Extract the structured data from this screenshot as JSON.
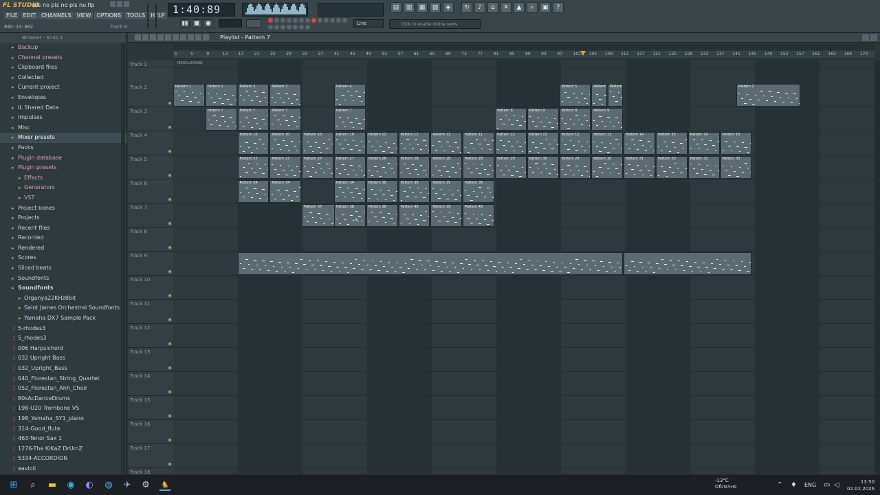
{
  "app": {
    "logo": "FL STUDIO",
    "file_title": "pls no pls no pls no.flp",
    "menu": [
      "FILE",
      "EDIT",
      "CHANNELS",
      "VIEW",
      "OPTIONS",
      "TOOLS",
      "HELP"
    ],
    "time_readout": "044:13:002",
    "track_label": "Track 8",
    "song_time": "1:40:89",
    "line_mode": "Line",
    "news_text": "Click to enable online news"
  },
  "browser": {
    "header": "Browser - Snap 1",
    "items": [
      {
        "label": "Backup",
        "kind": "folder",
        "style": "pink"
      },
      {
        "label": "Channel presets",
        "kind": "folder",
        "style": "pink"
      },
      {
        "label": "Clipboard files",
        "kind": "folder",
        "style": ""
      },
      {
        "label": "Collected",
        "kind": "folder",
        "style": ""
      },
      {
        "label": "Current project",
        "kind": "folder",
        "style": ""
      },
      {
        "label": "Envelopes",
        "kind": "folder",
        "style": ""
      },
      {
        "label": "IL Shared Data",
        "kind": "folder",
        "style": ""
      },
      {
        "label": "Impulses",
        "kind": "folder",
        "style": ""
      },
      {
        "label": "Misc",
        "kind": "folder",
        "style": ""
      },
      {
        "label": "Mixer presets",
        "kind": "folder",
        "style": "sel"
      },
      {
        "label": "Packs",
        "kind": "folder",
        "style": ""
      },
      {
        "label": "Plugin database",
        "kind": "folder",
        "style": "pink"
      },
      {
        "label": "Plugin presets",
        "kind": "folder",
        "style": "pink"
      },
      {
        "label": "Effects",
        "kind": "sub",
        "style": "pink"
      },
      {
        "label": "Generators",
        "kind": "sub",
        "style": "pink"
      },
      {
        "label": "VST",
        "kind": "sub",
        "style": "pink"
      },
      {
        "label": "Project bones",
        "kind": "folder",
        "style": ""
      },
      {
        "label": "Projects",
        "kind": "folder",
        "style": ""
      },
      {
        "label": "Recent files",
        "kind": "folder",
        "style": ""
      },
      {
        "label": "Recorded",
        "kind": "folder",
        "style": ""
      },
      {
        "label": "Rendered",
        "kind": "folder",
        "style": ""
      },
      {
        "label": "Scores",
        "kind": "folder",
        "style": ""
      },
      {
        "label": "Sliced beats",
        "kind": "folder",
        "style": ""
      },
      {
        "label": "Soundfonts",
        "kind": "folder",
        "style": ""
      },
      {
        "label": "Soundfonts",
        "kind": "folder",
        "style": "bold"
      },
      {
        "label": "Organya22KHz8bit",
        "kind": "sub",
        "style": ""
      },
      {
        "label": "Saint James Orchestral Soundfonts",
        "kind": "sub",
        "style": ""
      },
      {
        "label": "Yamaha DX7 Sample Pack",
        "kind": "sub",
        "style": ""
      },
      {
        "label": "5-rhodes3",
        "kind": "file",
        "style": ""
      },
      {
        "label": "5_rhodes3",
        "kind": "file",
        "style": ""
      },
      {
        "label": "006 Harpsichord",
        "kind": "file",
        "style": ""
      },
      {
        "label": "032 Upright Bass",
        "kind": "file",
        "style": ""
      },
      {
        "label": "032_Upright_Bass",
        "kind": "file",
        "style": ""
      },
      {
        "label": "040_Florestan_String_Quartet",
        "kind": "file",
        "style": ""
      },
      {
        "label": "052_Florestan_Ahh_Choir",
        "kind": "file",
        "style": ""
      },
      {
        "label": "80sAcDanceDrums",
        "kind": "file",
        "style": ""
      },
      {
        "label": "198-U20 Trombone VS",
        "kind": "file",
        "style": ""
      },
      {
        "label": "198_Yamaha_SY1_piano",
        "kind": "file",
        "style": ""
      },
      {
        "label": "314-Good_flute",
        "kind": "file",
        "style": ""
      },
      {
        "label": "463-Tenor Sax 1",
        "kind": "file",
        "style": ""
      },
      {
        "label": "1276-The KiKaZ DrUmZ",
        "kind": "file",
        "style": ""
      },
      {
        "label": "5334-ACCORDION",
        "kind": "file",
        "style": ""
      },
      {
        "label": "aavioli",
        "kind": "file",
        "style": ""
      },
      {
        "label": "acoustic_grand_piano_ydp_20080910",
        "kind": "file",
        "style": ""
      },
      {
        "label": "ArabicDrums",
        "kind": "file",
        "style": ""
      },
      {
        "label": "Arachno SoundFont - Version 1.0",
        "kind": "file",
        "style": ""
      }
    ]
  },
  "playlist": {
    "title": "Playlist - Pattern 7",
    "ruler": [
      "1",
      "5",
      "9",
      "13",
      "17",
      "21",
      "25",
      "29",
      "33",
      "37",
      "41",
      "45",
      "49",
      "53",
      "57",
      "61",
      "65",
      "69",
      "73",
      "77",
      "81",
      "85",
      "89",
      "93",
      "97",
      "101",
      "105",
      "109",
      "113",
      "117",
      "121",
      "125",
      "129",
      "133",
      "137",
      "141",
      "145",
      "149",
      "153",
      "157",
      "161",
      "165",
      "169",
      "173"
    ],
    "tracks": [
      "Track 1",
      "Track 2",
      "Track 3",
      "Track 4",
      "Track 5",
      "Track 6",
      "Track 7",
      "Track 8",
      "Track 9",
      "Track 10",
      "Track 11",
      "Track 12",
      "Track 13",
      "Track 14",
      "Track 15",
      "Track 16",
      "Track 17",
      "Track 18"
    ],
    "marker_label": "MEGALOVANIA",
    "clips": [
      {
        "track": 1,
        "pattern": "Pattern 1",
        "start": 0,
        "len": 2
      },
      {
        "track": 1,
        "pattern": "Pattern 1",
        "start": 2,
        "len": 2
      },
      {
        "track": 1,
        "pattern": "Pattern 3",
        "start": 4,
        "len": 2
      },
      {
        "track": 1,
        "pattern": "Pattern 3",
        "start": 6,
        "len": 2
      },
      {
        "track": 1,
        "pattern": "Pattern 4",
        "start": 10,
        "len": 2
      },
      {
        "track": 1,
        "pattern": "Pattern 5",
        "start": 24,
        "len": 2
      },
      {
        "track": 1,
        "pattern": "Pattern 5",
        "start": 26,
        "len": 1
      },
      {
        "track": 1,
        "pattern": "Pattern 5",
        "start": 27,
        "len": 1
      },
      {
        "track": 1,
        "pattern": "Pattern 2",
        "start": 35,
        "len": 4
      },
      {
        "track": 2,
        "pattern": "Pattern 7",
        "start": 2,
        "len": 2
      },
      {
        "track": 2,
        "pattern": "Pattern 7",
        "start": 4,
        "len": 2
      },
      {
        "track": 2,
        "pattern": "Pattern 7",
        "start": 6,
        "len": 2
      },
      {
        "track": 2,
        "pattern": "Pattern 7",
        "start": 10,
        "len": 2
      },
      {
        "track": 2,
        "pattern": "Pattern 8",
        "start": 20,
        "len": 2
      },
      {
        "track": 2,
        "pattern": "Pattern 9",
        "start": 22,
        "len": 2
      },
      {
        "track": 2,
        "pattern": "Pattern 8",
        "start": 24,
        "len": 2
      },
      {
        "track": 2,
        "pattern": "Pattern 9",
        "start": 26,
        "len": 2
      },
      {
        "track": 3,
        "pattern": "Pattern 10",
        "start": 4,
        "len": 2
      },
      {
        "track": 3,
        "pattern": "Pattern 10",
        "start": 6,
        "len": 2
      },
      {
        "track": 3,
        "pattern": "Pattern 10",
        "start": 8,
        "len": 2
      },
      {
        "track": 3,
        "pattern": "Pattern 10",
        "start": 10,
        "len": 2
      },
      {
        "track": 3,
        "pattern": "Pattern 11",
        "start": 12,
        "len": 2
      },
      {
        "track": 3,
        "pattern": "Pattern 11",
        "start": 14,
        "len": 2
      },
      {
        "track": 3,
        "pattern": "Pattern 11",
        "start": 16,
        "len": 2
      },
      {
        "track": 3,
        "pattern": "Pattern 11",
        "start": 18,
        "len": 2
      },
      {
        "track": 3,
        "pattern": "Pattern 12",
        "start": 20,
        "len": 2
      },
      {
        "track": 3,
        "pattern": "Pattern 13",
        "start": 22,
        "len": 2
      },
      {
        "track": 3,
        "pattern": "Pattern 12",
        "start": 24,
        "len": 2
      },
      {
        "track": 3,
        "pattern": "Pattern 13",
        "start": 26,
        "len": 2
      },
      {
        "track": 3,
        "pattern": "Pattern 14",
        "start": 28,
        "len": 2
      },
      {
        "track": 3,
        "pattern": "Pattern 15",
        "start": 30,
        "len": 2
      },
      {
        "track": 3,
        "pattern": "Pattern 14",
        "start": 32,
        "len": 2
      },
      {
        "track": 3,
        "pattern": "Pattern 15",
        "start": 34,
        "len": 2
      },
      {
        "track": 4,
        "pattern": "Pattern 27",
        "start": 4,
        "len": 2
      },
      {
        "track": 4,
        "pattern": "Pattern 27",
        "start": 6,
        "len": 2
      },
      {
        "track": 4,
        "pattern": "Pattern 27",
        "start": 8,
        "len": 2
      },
      {
        "track": 4,
        "pattern": "Pattern 27",
        "start": 10,
        "len": 2
      },
      {
        "track": 4,
        "pattern": "Pattern 28",
        "start": 12,
        "len": 2
      },
      {
        "track": 4,
        "pattern": "Pattern 28",
        "start": 14,
        "len": 2
      },
      {
        "track": 4,
        "pattern": "Pattern 28",
        "start": 16,
        "len": 2
      },
      {
        "track": 4,
        "pattern": "Pattern 28",
        "start": 18,
        "len": 2
      },
      {
        "track": 4,
        "pattern": "Pattern 29",
        "start": 20,
        "len": 2
      },
      {
        "track": 4,
        "pattern": "Pattern 30",
        "start": 22,
        "len": 2
      },
      {
        "track": 4,
        "pattern": "Pattern 29",
        "start": 24,
        "len": 2
      },
      {
        "track": 4,
        "pattern": "Pattern 30",
        "start": 26,
        "len": 2
      },
      {
        "track": 4,
        "pattern": "Pattern 31",
        "start": 28,
        "len": 2
      },
      {
        "track": 4,
        "pattern": "Pattern 33",
        "start": 30,
        "len": 2
      },
      {
        "track": 4,
        "pattern": "Pattern 31",
        "start": 32,
        "len": 2
      },
      {
        "track": 4,
        "pattern": "Pattern 33",
        "start": 34,
        "len": 2
      },
      {
        "track": 5,
        "pattern": "Pattern 34",
        "start": 4,
        "len": 2
      },
      {
        "track": 5,
        "pattern": "Pattern 34",
        "start": 6,
        "len": 2
      },
      {
        "track": 5,
        "pattern": "Pattern 34",
        "start": 10,
        "len": 2
      },
      {
        "track": 5,
        "pattern": "Pattern 35",
        "start": 12,
        "len": 2
      },
      {
        "track": 5,
        "pattern": "Pattern 36",
        "start": 14,
        "len": 2
      },
      {
        "track": 5,
        "pattern": "Pattern 35",
        "start": 16,
        "len": 2
      },
      {
        "track": 5,
        "pattern": "Pattern 36",
        "start": 18,
        "len": 2
      },
      {
        "track": 6,
        "pattern": "Pattern 37",
        "start": 8,
        "len": 4
      },
      {
        "track": 6,
        "pattern": "Pattern 38",
        "start": 10,
        "len": 2
      },
      {
        "track": 6,
        "pattern": "Pattern 39",
        "start": 12,
        "len": 2
      },
      {
        "track": 6,
        "pattern": "Pattern 40",
        "start": 14,
        "len": 2
      },
      {
        "track": 6,
        "pattern": "Pattern 39",
        "start": 16,
        "len": 2
      },
      {
        "track": 6,
        "pattern": "Pattern 40",
        "start": 18,
        "len": 2
      },
      {
        "track": 8,
        "pattern": "",
        "start": 4,
        "len": 24
      },
      {
        "track": 8,
        "pattern": "",
        "start": 28,
        "len": 8
      }
    ]
  },
  "taskbar": {
    "weather_temp": "-13°C",
    "weather_desc": "Облачно",
    "lang": "ENG",
    "time": "13:50",
    "date": "02.02.2026",
    "notification_count": "1"
  }
}
